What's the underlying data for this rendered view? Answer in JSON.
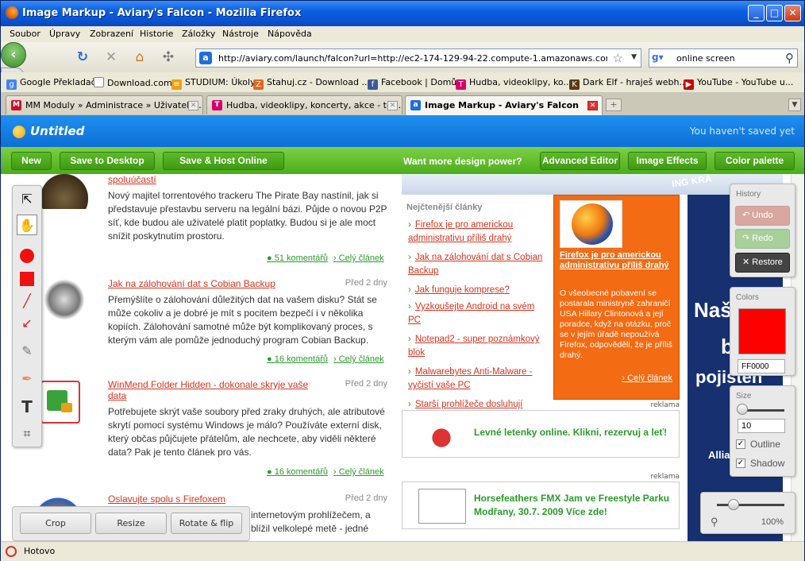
{
  "window": {
    "title": "Image Markup - Aviary's Falcon - Mozilla Firefox",
    "buttons": {
      "minimize": "_",
      "maximize": "□",
      "close": "✕"
    }
  },
  "menu": [
    "Soubor",
    "Úpravy",
    "Zobrazení",
    "Historie",
    "Záložky",
    "Nástroje",
    "Nápověda"
  ],
  "nav": {
    "url": "http://aviary.com/launch/falcon?url=http://ec2-174-129-94-22.compute-1.amazonaws.com/captures/",
    "search": "online screen"
  },
  "bookmarks": [
    "Google Překladač",
    "Download.com",
    "STUDIUM: Úkoly",
    "Stahuj.cz - Download ...",
    "Facebook | Domů",
    "Hudba, videoklipy, ko...",
    "Dark Elf - hraješ webh...",
    "YouTube - YouTube u..."
  ],
  "tabs": [
    {
      "label": "MM Moduly » Administrace » Uživatelsk...",
      "active": false
    },
    {
      "label": "Hudba, videoklipy, koncerty, akce - t-m...",
      "active": false
    },
    {
      "label": "Image Markup - Aviary's Falcon",
      "active": true
    }
  ],
  "aviary": {
    "doc_title": "Untitled",
    "save_status": "You haven't saved yet",
    "buttons": {
      "new": "New",
      "save_desktop": "Save to Desktop",
      "save_host": "Save & Host Online",
      "advanced": "Advanced Editor",
      "effects": "Image Effects",
      "palette": "Color palette"
    },
    "want_more": "Want more design power?",
    "bottom": {
      "crop": "Crop",
      "resize": "Resize",
      "rotate": "Rotate & flip"
    },
    "history": {
      "caption": "History",
      "undo": "Undo",
      "redo": "Redo",
      "restore": "Restore"
    },
    "colors": {
      "caption": "Colors",
      "hex": "FF0000",
      "swatch": "#ff0000"
    },
    "size": {
      "caption": "Size",
      "value": "10",
      "slider_level": 0.05,
      "outline": "Outline",
      "shadow": "Shadow"
    },
    "zoom": {
      "value": "100%",
      "slider_level": 0.25
    }
  },
  "page": {
    "articles": [
      {
        "title": "spoluúčastí",
        "date": "",
        "body": "Nový majitel torrentového trackeru The Pirate Bay nastínil, jak si představuje přestavbu serveru na legální bázi. Půjde o novou P2P síť, kde budou ale uživatelé platit poplatky. Budou si je ale moct snížit poskytnutím prostoru.",
        "comments": "51 komentářů",
        "full": "Celý článek"
      },
      {
        "title": "Jak na zálohování dat s Cobian Backup",
        "date": "Před 2 dny",
        "body": "Přemýšlíte o zálohování důležitých dat na vašem disku? Stát se může cokoliv a je dobré je mít s pocitem bezpečí i v několika kopiích. Zálohování samotné může být komplikovaný proces, s kterým vám ale pomůže jednoduchý program Cobian Backup.",
        "comments": "16 komentářů",
        "full": "Celý článek"
      },
      {
        "title": "WinMend Folder Hidden - dokonale skryje vaše data",
        "date": "Před 2 dny",
        "body": "Potřebujete skrýt vaše soubory před zraky druhých, ale atributové skrytí pomocí systému Windows je málo? Používáte externí disk, který občas půjčujete přátelům, ale nechcete, aby viděli některé data? Pak je tento článek pro vás.",
        "comments": "16 komentářů",
        "full": "Celý článek"
      },
      {
        "title": "Oslavujte spolu s Firefoxem",
        "date": "Před 2 dny",
        "body": "internetovým prohlížečem, a blížil velkolepé metě - jedné"
      }
    ],
    "newest_head": "Nejčtenější články",
    "newest": [
      "Firefox je pro americkou administrativu příliš drahý",
      "Jak na zálohování dat s Cobian Backup",
      "Jak funguje komprese?",
      "Vyzkoušejte Android na svém PC",
      "Notepad2 - super poznámkový blok",
      "Malwarebytes Anti-Malware - vyčistí vaše PC",
      "Starší prohlížeče dosluhují"
    ],
    "feature": {
      "title": "Firefox je pro americkou administrativu příliš drahý",
      "body": "O všeobecné pobavení se postarala ministryně zahraničí USA Hillary Clintonová a její poradce, když na otázku, proč se v jejím úřadě nepoužívá Firefox, odpověděli, že je příliš drahý.",
      "more": "Celý článek"
    },
    "ads": [
      {
        "label": "reklama",
        "text": "Levné letenky online. Klikni, rezervuj a leť!"
      },
      {
        "label": "reklama",
        "text": "Horsefeathers FMX Jam ve Freestyle Parku Modřany, 30.7. 2009 Více zde!"
      }
    ],
    "banner": [
      "Naš",
      "b",
      "pojisten",
      "Allia"
    ],
    "strip": "ING KRÁ"
  },
  "status": "Hotovo"
}
